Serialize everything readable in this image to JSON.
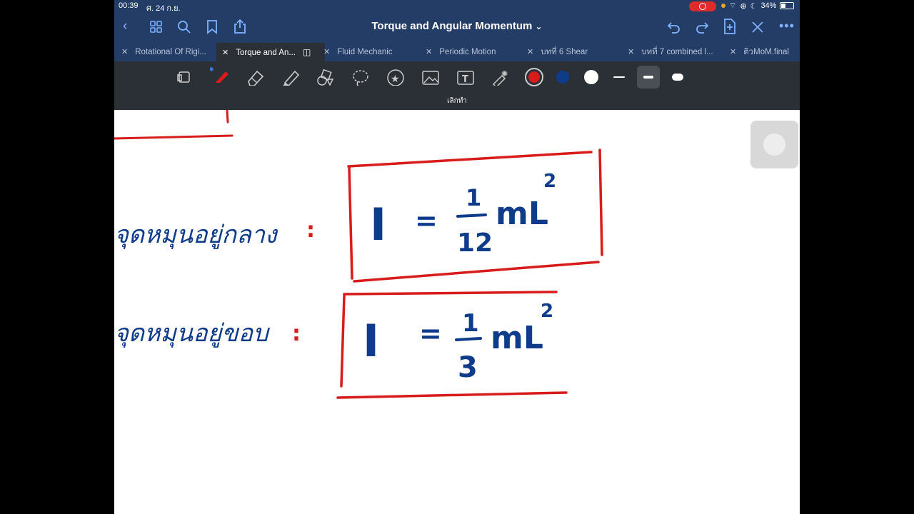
{
  "status": {
    "time": "00:39",
    "date": "ศ. 24 ก.ย.",
    "battery": "34%"
  },
  "window": {
    "title": "Torque and Angular Momentum",
    "title_chevron": "⌄"
  },
  "tabs": [
    {
      "label": "Rotational Of Rigi...",
      "active": false
    },
    {
      "label": "Torque and An...",
      "active": true
    },
    {
      "label": "Fluid Mechanic",
      "active": false
    },
    {
      "label": "Periodic Motion",
      "active": false
    },
    {
      "label": "บทที่ 6 Shear",
      "active": false
    },
    {
      "label": "บทที่ 7 combined l...",
      "active": false
    },
    {
      "label": "ติวMoM.final",
      "active": false
    }
  ],
  "toolbar": {
    "undo_label": "เลิกทำ",
    "colors": {
      "red": "#d81b1b",
      "blue": "#0f3c8a",
      "white": "#ffffff"
    }
  },
  "note": {
    "row1_label": "จุดหมุนอยู่กลาง",
    "row1_I": "I",
    "row1_eq": "=",
    "row1_num": "1",
    "row1_den": "12",
    "row1_mL": "mL",
    "row1_exp": "2",
    "row2_label": "จุดหมุนอยู่ขอบ",
    "row2_I": "I",
    "row2_eq": "=",
    "row2_num": "1",
    "row2_den": "3",
    "row2_mL": "mL",
    "row2_exp": "2",
    "colon": ":"
  }
}
